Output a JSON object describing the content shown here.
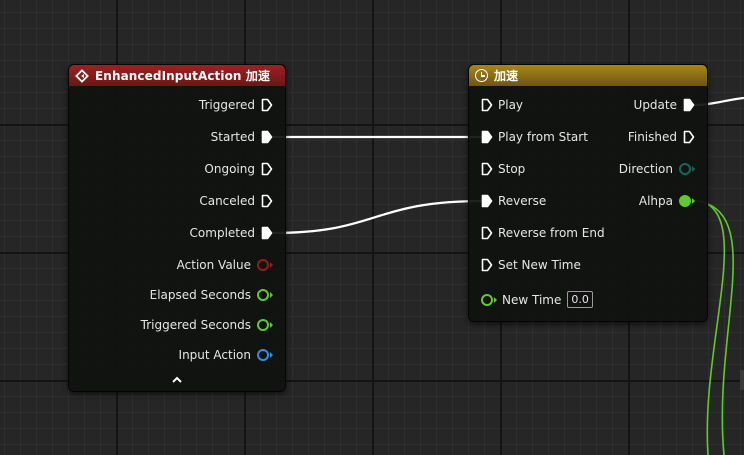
{
  "input_node": {
    "title": "EnhancedInputAction 加速",
    "header_color": "#8a1d1d",
    "icon": "diamond-event-icon",
    "outputs": [
      {
        "label": "Triggered",
        "type": "exec",
        "connected": false
      },
      {
        "label": "Started",
        "type": "exec",
        "connected": true
      },
      {
        "label": "Ongoing",
        "type": "exec",
        "connected": false
      },
      {
        "label": "Canceled",
        "type": "exec",
        "connected": false
      },
      {
        "label": "Completed",
        "type": "exec",
        "connected": true
      },
      {
        "label": "Action Value",
        "type": "data",
        "color": "#9a1a1a"
      },
      {
        "label": "Elapsed Seconds",
        "type": "data",
        "color": "#5fc92e"
      },
      {
        "label": "Triggered Seconds",
        "type": "data",
        "color": "#5fc92e"
      },
      {
        "label": "Input Action",
        "type": "data",
        "color": "#2f8fe0"
      }
    ],
    "collapse_glyph": "^"
  },
  "timeline_node": {
    "title": "加速",
    "header_color": "#8a6d12",
    "icon": "clock-icon",
    "inputs": [
      {
        "label": "Play",
        "type": "exec",
        "connected": false
      },
      {
        "label": "Play from Start",
        "type": "exec",
        "connected": true
      },
      {
        "label": "Stop",
        "type": "exec",
        "connected": false
      },
      {
        "label": "Reverse",
        "type": "exec",
        "connected": true
      },
      {
        "label": "Reverse from End",
        "type": "exec",
        "connected": false
      },
      {
        "label": "Set New Time",
        "type": "exec",
        "connected": false
      },
      {
        "label": "New Time",
        "type": "data",
        "color": "#5fc92e",
        "value": "0.0"
      }
    ],
    "outputs": [
      {
        "label": "Update",
        "type": "exec",
        "connected": true
      },
      {
        "label": "Finished",
        "type": "exec",
        "connected": false
      },
      {
        "label": "Direction",
        "type": "data",
        "color": "#0e6b5c"
      },
      {
        "label": "Alhpa",
        "type": "data",
        "color": "#5fc92e",
        "filled": true
      }
    ]
  },
  "colors": {
    "exec_wire": "#ffffff",
    "float_wire": "#5fc92e"
  }
}
